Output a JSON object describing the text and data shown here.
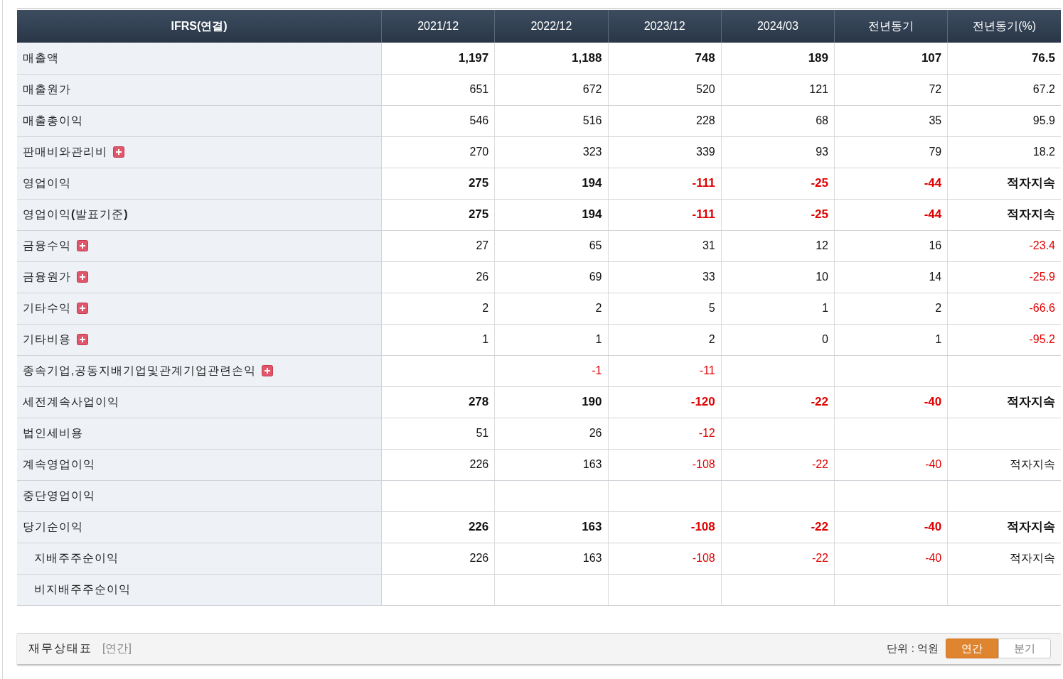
{
  "table": {
    "corner": "IFRS(연결)",
    "columns": [
      "2021/12",
      "2022/12",
      "2023/12",
      "2024/03",
      "전년동기",
      "전년동기(%)"
    ],
    "rows": [
      {
        "label": "매출액",
        "bold": true,
        "expandable": false,
        "cells": [
          {
            "text": "1,197",
            "negative": false
          },
          {
            "text": "1,188",
            "negative": false
          },
          {
            "text": "748",
            "negative": false
          },
          {
            "text": "189",
            "negative": false
          },
          {
            "text": "107",
            "negative": false
          },
          {
            "text": "76.5",
            "negative": false
          }
        ]
      },
      {
        "label": "매출원가",
        "bold": false,
        "expandable": false,
        "cells": [
          {
            "text": "651",
            "negative": false
          },
          {
            "text": "672",
            "negative": false
          },
          {
            "text": "520",
            "negative": false
          },
          {
            "text": "121",
            "negative": false
          },
          {
            "text": "72",
            "negative": false
          },
          {
            "text": "67.2",
            "negative": false
          }
        ]
      },
      {
        "label": "매출총이익",
        "bold": false,
        "expandable": false,
        "cells": [
          {
            "text": "546",
            "negative": false
          },
          {
            "text": "516",
            "negative": false
          },
          {
            "text": "228",
            "negative": false
          },
          {
            "text": "68",
            "negative": false
          },
          {
            "text": "35",
            "negative": false
          },
          {
            "text": "95.9",
            "negative": false
          }
        ]
      },
      {
        "label": "판매비와관리비",
        "bold": false,
        "expandable": true,
        "cells": [
          {
            "text": "270",
            "negative": false
          },
          {
            "text": "323",
            "negative": false
          },
          {
            "text": "339",
            "negative": false
          },
          {
            "text": "93",
            "negative": false
          },
          {
            "text": "79",
            "negative": false
          },
          {
            "text": "18.2",
            "negative": false
          }
        ]
      },
      {
        "label": "영업이익",
        "bold": true,
        "expandable": false,
        "cells": [
          {
            "text": "275",
            "negative": false
          },
          {
            "text": "194",
            "negative": false
          },
          {
            "text": "-111",
            "negative": true
          },
          {
            "text": "-25",
            "negative": true
          },
          {
            "text": "-44",
            "negative": true
          },
          {
            "text": "적자지속",
            "negative": false
          }
        ]
      },
      {
        "label": "영업이익**(**발표기준**)**",
        "bold": true,
        "expandable": false,
        "cells": [
          {
            "text": "275",
            "negative": false
          },
          {
            "text": "194",
            "negative": false
          },
          {
            "text": "-111",
            "negative": true
          },
          {
            "text": "-25",
            "negative": true
          },
          {
            "text": "-44",
            "negative": true
          },
          {
            "text": "적자지속",
            "negative": false
          }
        ]
      },
      {
        "label": "금융수익",
        "bold": false,
        "expandable": true,
        "cells": [
          {
            "text": "27",
            "negative": false
          },
          {
            "text": "65",
            "negative": false
          },
          {
            "text": "31",
            "negative": false
          },
          {
            "text": "12",
            "negative": false
          },
          {
            "text": "16",
            "negative": false
          },
          {
            "text": "-23.4",
            "negative": true
          }
        ]
      },
      {
        "label": "금융원가",
        "bold": false,
        "expandable": true,
        "cells": [
          {
            "text": "26",
            "negative": false
          },
          {
            "text": "69",
            "negative": false
          },
          {
            "text": "33",
            "negative": false
          },
          {
            "text": "10",
            "negative": false
          },
          {
            "text": "14",
            "negative": false
          },
          {
            "text": "-25.9",
            "negative": true
          }
        ]
      },
      {
        "label": "기타수익",
        "bold": false,
        "expandable": true,
        "cells": [
          {
            "text": "2",
            "negative": false
          },
          {
            "text": "2",
            "negative": false
          },
          {
            "text": "5",
            "negative": false
          },
          {
            "text": "1",
            "negative": false
          },
          {
            "text": "2",
            "negative": false
          },
          {
            "text": "-66.6",
            "negative": true
          }
        ]
      },
      {
        "label": "기타비용",
        "bold": false,
        "expandable": true,
        "cells": [
          {
            "text": "1",
            "negative": false
          },
          {
            "text": "1",
            "negative": false
          },
          {
            "text": "2",
            "negative": false
          },
          {
            "text": "0",
            "negative": false
          },
          {
            "text": "1",
            "negative": false
          },
          {
            "text": "-95.2",
            "negative": true
          }
        ]
      },
      {
        "label": "종속기업,공동지배기업및관계기업관련손익",
        "bold": false,
        "expandable": true,
        "cells": [
          null,
          {
            "text": "-1",
            "negative": true
          },
          {
            "text": "-11",
            "negative": true
          },
          null,
          null,
          null
        ]
      },
      {
        "label": "세전계속사업이익",
        "bold": true,
        "expandable": false,
        "cells": [
          {
            "text": "278",
            "negative": false
          },
          {
            "text": "190",
            "negative": false
          },
          {
            "text": "-120",
            "negative": true
          },
          {
            "text": "-22",
            "negative": true
          },
          {
            "text": "-40",
            "negative": true
          },
          {
            "text": "적자지속",
            "negative": false
          }
        ]
      },
      {
        "label": "법인세비용",
        "bold": false,
        "expandable": false,
        "cells": [
          {
            "text": "51",
            "negative": false
          },
          {
            "text": "26",
            "negative": false
          },
          {
            "text": "-12",
            "negative": true
          },
          null,
          null,
          null
        ]
      },
      {
        "label": "계속영업이익",
        "bold": false,
        "expandable": false,
        "cells": [
          {
            "text": "226",
            "negative": false
          },
          {
            "text": "163",
            "negative": false
          },
          {
            "text": "-108",
            "negative": true
          },
          {
            "text": "-22",
            "negative": true
          },
          {
            "text": "-40",
            "negative": true
          },
          {
            "text": "적자지속",
            "negative": false
          }
        ]
      },
      {
        "label": "중단영업이익",
        "expandable": false,
        "cells": [
          null,
          null,
          null,
          null,
          null,
          null
        ]
      },
      {
        "label": "당기순이익",
        "bold": true,
        "expandable": false,
        "cells": [
          {
            "text": "226",
            "negative": false
          },
          {
            "text": "163",
            "negative": false
          },
          {
            "text": "-108",
            "negative": true
          },
          {
            "text": "-22",
            "negative": true
          },
          {
            "text": "-40",
            "negative": true
          },
          {
            "text": "적자지속",
            "negative": false
          }
        ],
        "children": [
          {
            "label": "지배주주순이익",
            "bold": false,
            "expandable": false,
            "cells": [
              {
                "text": "226",
                "negative": false
              },
              {
                "text": "163",
                "negative": false
              },
              {
                "text": "-108",
                "negative": true
              },
              {
                "text": "-22",
                "negative": true
              },
              {
                "text": "-40",
                "negative": true
              },
              {
                "text": "적자지속",
                "negative": false
              }
            ]
          },
          {
            "label": "비지배주주순이익",
            "expandable": false,
            "cells": [
              null,
              null,
              null,
              null,
              null,
              null
            ]
          }
        ]
      }
    ]
  },
  "footer": {
    "title": "재무상태표",
    "period": "[연간]",
    "unit": "단위 : 억원",
    "toggle": [
      {
        "label": "연간",
        "selected": true
      },
      {
        "label": "분기",
        "selected": false
      }
    ]
  }
}
